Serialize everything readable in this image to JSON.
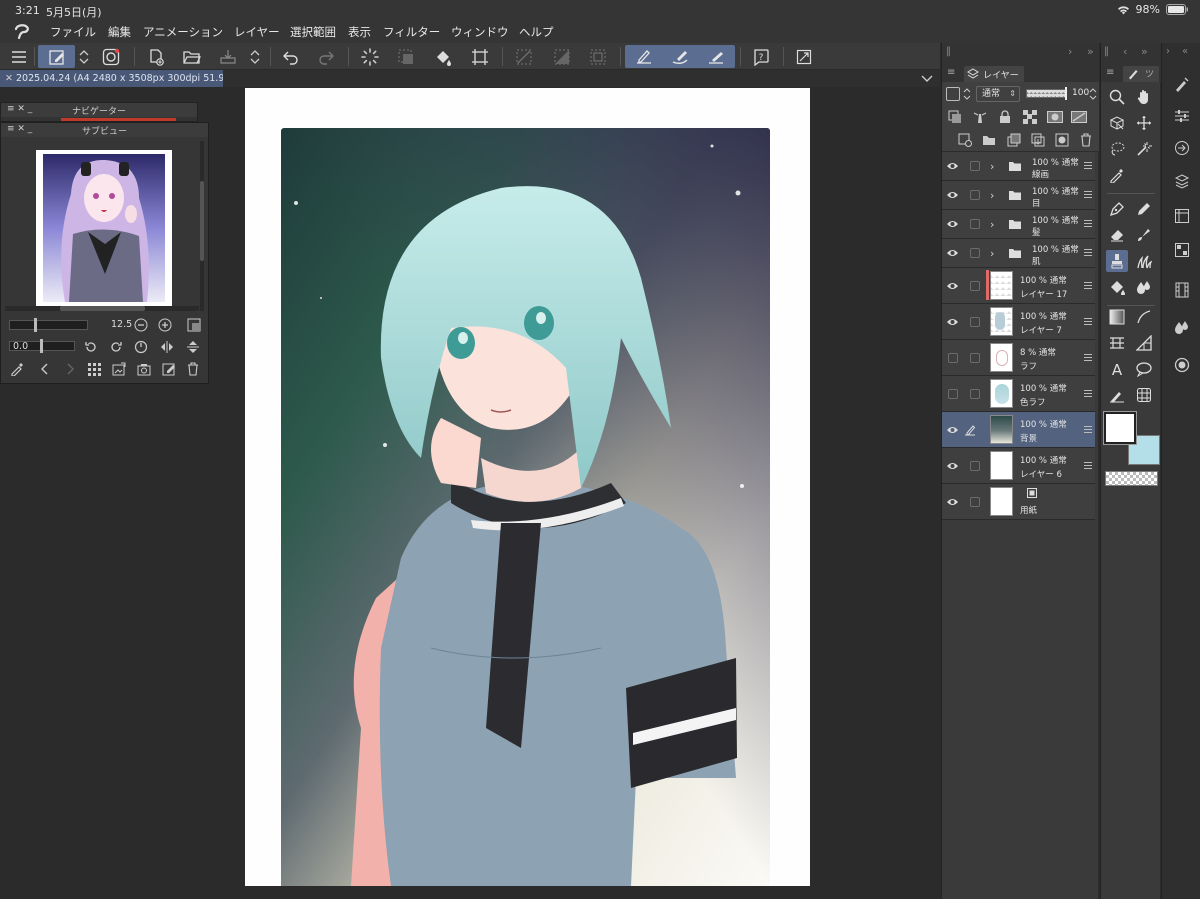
{
  "status_bar": {
    "time": "3:21",
    "date": "5月5日(月)",
    "battery": "98%"
  },
  "menu": {
    "items": [
      "ファイル",
      "編集",
      "アニメーション",
      "レイヤー",
      "選択範囲",
      "表示",
      "フィルター",
      "ウィンドウ",
      "ヘルプ"
    ]
  },
  "document_tab": {
    "title": "2025.04.24 (A4 2480 x 3508px 300dpi 51.9%)"
  },
  "navigator": {
    "title": "ナビゲーター"
  },
  "subview": {
    "title": "サブビュー",
    "zoom": "12.5",
    "rotation": "0.0"
  },
  "layer_panel": {
    "tab_label": "レイヤー",
    "blend_mode": "通常",
    "opacity": "100",
    "layers": [
      {
        "opacity": "100 %",
        "mode": "通常",
        "name": "線画",
        "type": "folder"
      },
      {
        "opacity": "100 %",
        "mode": "通常",
        "name": "目",
        "type": "folder"
      },
      {
        "opacity": "100 %",
        "mode": "通常",
        "name": "髪",
        "type": "folder"
      },
      {
        "opacity": "100 %",
        "mode": "通常",
        "name": "肌",
        "type": "folder"
      },
      {
        "opacity": "100 %",
        "mode": "通常",
        "name": "レイヤー 17",
        "type": "raster"
      },
      {
        "opacity": "100 %",
        "mode": "通常",
        "name": "レイヤー 7",
        "type": "raster"
      },
      {
        "opacity": "8 %",
        "mode": "通常",
        "name": "ラフ",
        "type": "raster"
      },
      {
        "opacity": "100 %",
        "mode": "通常",
        "name": "色ラフ",
        "type": "raster"
      },
      {
        "opacity": "100 %",
        "mode": "通常",
        "name": "背景",
        "type": "raster",
        "selected": true
      },
      {
        "opacity": "100 %",
        "mode": "通常",
        "name": "レイヤー 6",
        "type": "raster"
      },
      {
        "opacity": "",
        "mode": "",
        "name": "用紙",
        "type": "paper"
      }
    ]
  },
  "colors": {
    "accent": "#5b6e92",
    "main_color": "#ffffff",
    "sub_color": "#b4dfe9",
    "selected_layer": "#52627f"
  }
}
